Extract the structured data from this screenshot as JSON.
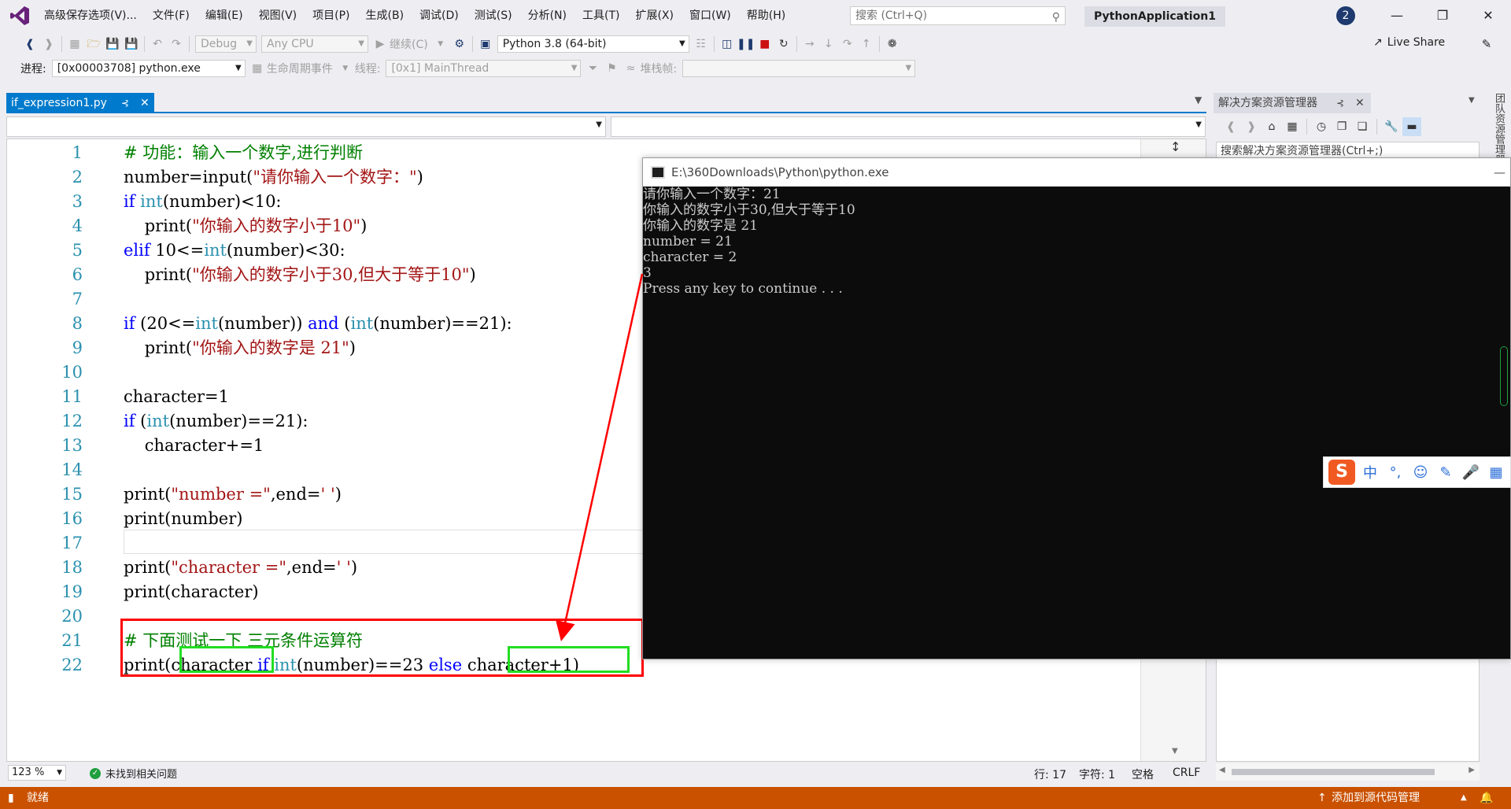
{
  "menu": {
    "items": [
      "高级保存选项(V)...",
      "文件(F)",
      "编辑(E)",
      "视图(V)",
      "项目(P)",
      "生成(B)",
      "调试(D)",
      "测试(S)",
      "分析(N)",
      "工具(T)",
      "扩展(X)",
      "窗口(W)",
      "帮助(H)"
    ]
  },
  "title": {
    "search_placeholder": "搜索 (Ctrl+Q)",
    "solution_name": "PythonApplication1",
    "notification_count": "2"
  },
  "toolbar": {
    "config": "Debug",
    "platform": "Any CPU",
    "continue_label": "继续(C)",
    "environment": "Python 3.8 (64-bit)",
    "live_share": "Live Share"
  },
  "debug_toolbar": {
    "process_label": "进程:",
    "process_value": "[0x00003708] python.exe",
    "lifecycle_label": "生命周期事件",
    "thread_label": "线程:",
    "thread_value": "[0x1] MainThread",
    "stackframe_label": "堆栈帧:"
  },
  "document": {
    "tab_name": "if_expression1.py"
  },
  "code": {
    "lines": [
      {
        "n": "1",
        "tokens": [
          [
            "cm",
            "# 功能：输入一个数字,进行判断"
          ]
        ]
      },
      {
        "n": "2",
        "tokens": [
          [
            "",
            "number=input("
          ],
          [
            "str",
            "\"请你输入一个数字：\""
          ],
          [
            "",
            ")"
          ]
        ]
      },
      {
        "n": "3",
        "tokens": [
          [
            "kw",
            "if "
          ],
          [
            "bi",
            "int"
          ],
          [
            "",
            "(number)<10:"
          ]
        ]
      },
      {
        "n": "4",
        "tokens": [
          [
            "",
            "    print("
          ],
          [
            "str",
            "\"你输入的数字小于10\""
          ],
          [
            "",
            ")"
          ]
        ]
      },
      {
        "n": "5",
        "tokens": [
          [
            "kw",
            "elif "
          ],
          [
            "",
            "10<="
          ],
          [
            "bi",
            "int"
          ],
          [
            "",
            "(number)<30:"
          ]
        ]
      },
      {
        "n": "6",
        "tokens": [
          [
            "",
            "    print("
          ],
          [
            "str",
            "\"你输入的数字小于30,但大于等于10\""
          ],
          [
            "",
            ")"
          ]
        ]
      },
      {
        "n": "7",
        "tokens": []
      },
      {
        "n": "8",
        "tokens": [
          [
            "kw",
            "if "
          ],
          [
            "",
            "(20<="
          ],
          [
            "bi",
            "int"
          ],
          [
            "",
            "(number)) "
          ],
          [
            "kw",
            "and"
          ],
          [
            "",
            " ("
          ],
          [
            "bi",
            "int"
          ],
          [
            "",
            "(number)==21):"
          ]
        ]
      },
      {
        "n": "9",
        "tokens": [
          [
            "",
            "    print("
          ],
          [
            "str",
            "\"你输入的数字是 21\""
          ],
          [
            "",
            ")"
          ]
        ]
      },
      {
        "n": "10",
        "tokens": []
      },
      {
        "n": "11",
        "tokens": [
          [
            "",
            "character=1"
          ]
        ]
      },
      {
        "n": "12",
        "tokens": [
          [
            "kw",
            "if "
          ],
          [
            "",
            "("
          ],
          [
            "bi",
            "int"
          ],
          [
            "",
            "(number)==21):"
          ]
        ]
      },
      {
        "n": "13",
        "tokens": [
          [
            "",
            "    character+=1"
          ]
        ]
      },
      {
        "n": "14",
        "tokens": []
      },
      {
        "n": "15",
        "tokens": [
          [
            "",
            "print("
          ],
          [
            "str",
            "\"number =\""
          ],
          [
            "",
            ",end="
          ],
          [
            "str",
            "' '"
          ],
          [
            "",
            ")"
          ]
        ]
      },
      {
        "n": "16",
        "tokens": [
          [
            "",
            "print(number)"
          ]
        ]
      },
      {
        "n": "17",
        "tokens": []
      },
      {
        "n": "18",
        "tokens": [
          [
            "",
            "print("
          ],
          [
            "str",
            "\"character =\""
          ],
          [
            "",
            ",end="
          ],
          [
            "str",
            "' '"
          ],
          [
            "",
            ")"
          ]
        ]
      },
      {
        "n": "19",
        "tokens": [
          [
            "",
            "print(character)"
          ]
        ]
      },
      {
        "n": "20",
        "tokens": []
      },
      {
        "n": "21",
        "tokens": [
          [
            "cm",
            "# 下面测试一下 三元条件运算符"
          ]
        ]
      },
      {
        "n": "22",
        "tokens": [
          [
            "",
            "print(character "
          ],
          [
            "kw",
            "if "
          ],
          [
            "bi",
            "int"
          ],
          [
            "",
            "(number)==23 "
          ],
          [
            "kw",
            "else "
          ],
          [
            "",
            "character+1)"
          ]
        ]
      }
    ]
  },
  "editor_status": {
    "zoom": "123 %",
    "issues": "未找到相关问题",
    "line": "行: 17",
    "char": "字符: 1",
    "whitespace": "空格",
    "line_ending": "CRLF"
  },
  "solution_explorer": {
    "title": "解决方案资源管理器",
    "search_placeholder": "搜索解决方案资源管理器(Ctrl+;)",
    "side_tab": "团队资源管理器"
  },
  "console": {
    "title": "E:\\360Downloads\\Python\\python.exe",
    "lines": [
      "请你输入一个数字：21",
      "你输入的数字小于30,但大于等于10",
      "你输入的数字是 21",
      "number = 21",
      "character = 2",
      "3",
      "Press any key to continue . . ."
    ]
  },
  "ime": {
    "logo": "S",
    "mode": "中",
    "punct": "°,",
    "emoji": "☺",
    "pen": "✎",
    "mic": "🎤",
    "grid": "▦"
  },
  "statusbar": {
    "ready": "就绪",
    "source_control": "添加到源代码管理"
  },
  "colors": {
    "accent": "#007acc",
    "status_bar": "#ca5100",
    "annotation_red": "#ff0000",
    "annotation_green": "#22dd22"
  }
}
